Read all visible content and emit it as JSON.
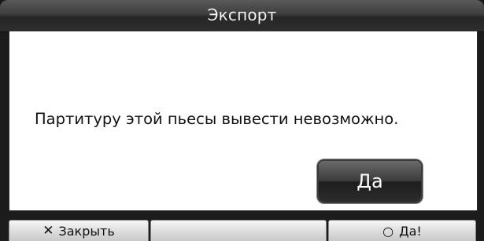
{
  "dialog": {
    "title": "Экспорт",
    "message": "Партитуру этой пьесы вывести невозможно.",
    "primary_button_label": "Да"
  },
  "bottom_bar": {
    "close_icon": "x-icon",
    "close_label": "Закрыть",
    "middle_label": "",
    "yes_icon": "circle-icon",
    "yes_label": "Да!"
  }
}
